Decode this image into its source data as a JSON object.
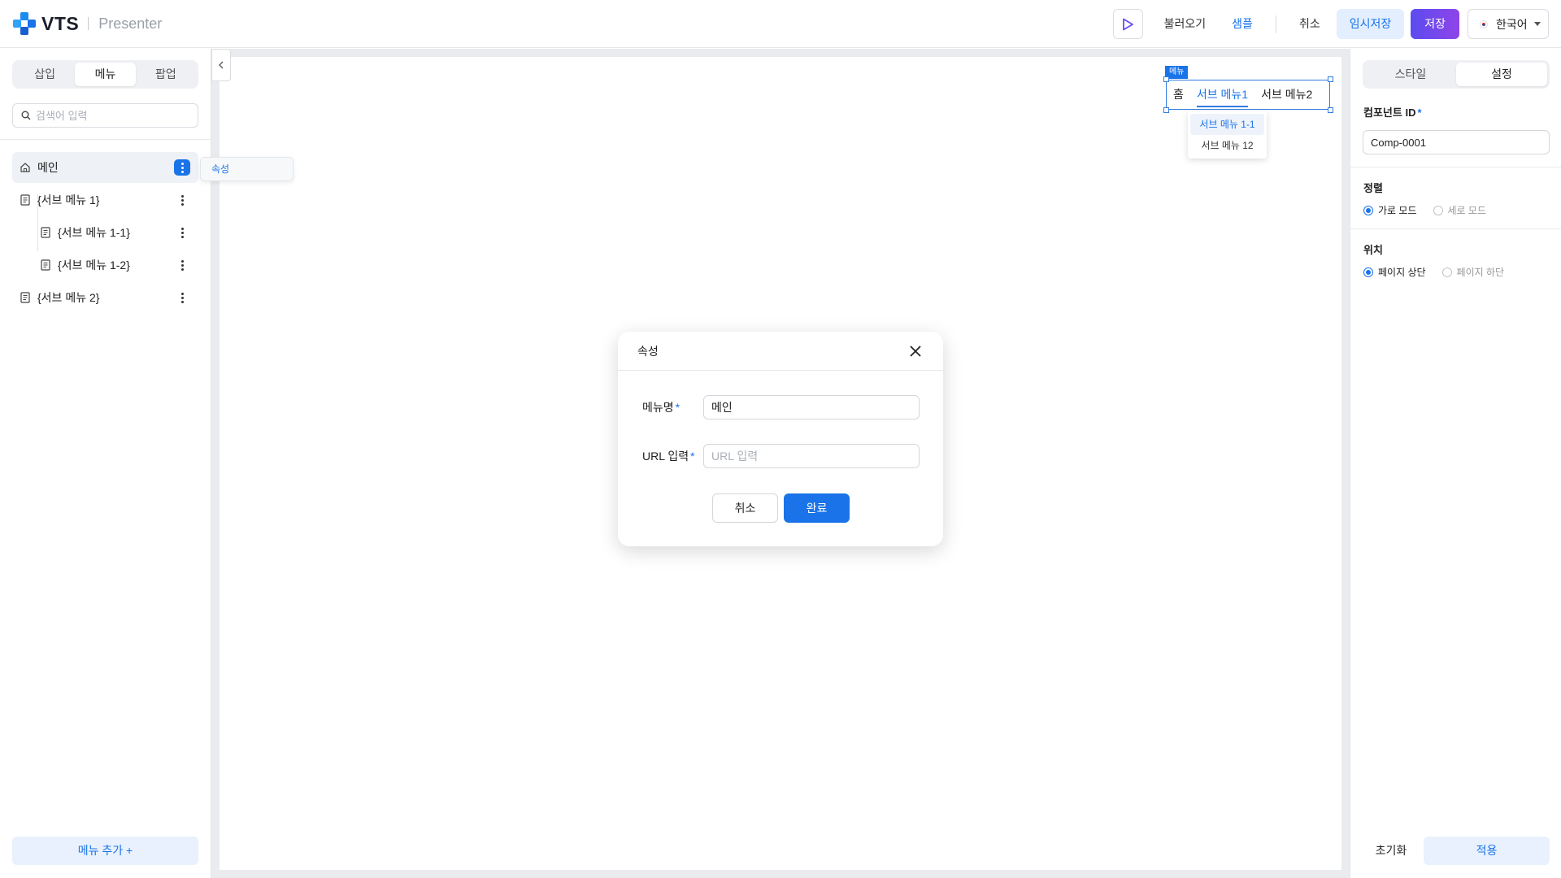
{
  "header": {
    "logo_text": "VTS",
    "logo_sub": "Presenter",
    "actions": {
      "load": "불러오기",
      "sample": "샘플",
      "cancel": "취소",
      "temp_save": "임시저장",
      "save": "저장"
    },
    "language": "한국어"
  },
  "left_panel": {
    "tabs": [
      {
        "label": "삽입",
        "active": false
      },
      {
        "label": "메뉴",
        "active": true
      },
      {
        "label": "팝업",
        "active": false
      }
    ],
    "search_placeholder": "검색어 입력",
    "tree": [
      {
        "label": "메인",
        "icon": "home-icon",
        "level": 0,
        "selected": true
      },
      {
        "label": "{서브 메뉴 1}",
        "icon": "document-icon",
        "level": 0
      },
      {
        "label": "{서브 메뉴 1-1}",
        "icon": "document-icon",
        "level": 1
      },
      {
        "label": "{서브 메뉴 1-2}",
        "icon": "document-icon",
        "level": 1
      },
      {
        "label": "{서브 메뉴 2}",
        "icon": "document-icon",
        "level": 0
      }
    ],
    "context_menu_item": "속성",
    "add_menu_label": "메뉴 추가 +"
  },
  "canvas": {
    "component_tag": "메뉴",
    "menu_items": [
      "홈",
      "서브 메뉴1",
      "서브 메뉴2"
    ],
    "active_menu": "서브 메뉴1",
    "submenu_items": [
      "서브 메뉴 1-1",
      "서브 메뉴 12"
    ]
  },
  "modal": {
    "title": "속성",
    "menu_name_label": "메뉴명",
    "menu_name_value": "메인",
    "url_label": "URL 입력",
    "url_placeholder": "URL 입력",
    "cancel_label": "취소",
    "confirm_label": "완료",
    "required_mark": "*"
  },
  "right_panel": {
    "tabs": [
      {
        "label": "스타일",
        "active": false
      },
      {
        "label": "설정",
        "active": true
      }
    ],
    "component_id_label": "컴포넌트 ID",
    "component_id_value": "Comp-0001",
    "align_label": "정렬",
    "align_options": [
      "가로 모드",
      "세로 모드"
    ],
    "position_label": "위치",
    "position_options": [
      "페이지 상단",
      "페이지 하단"
    ],
    "reset_label": "초기화",
    "apply_label": "적용"
  },
  "colors": {
    "accent": "#1a73e8",
    "save_gradient_start": "#5b4cf0",
    "save_gradient_end": "#8e44e8"
  }
}
